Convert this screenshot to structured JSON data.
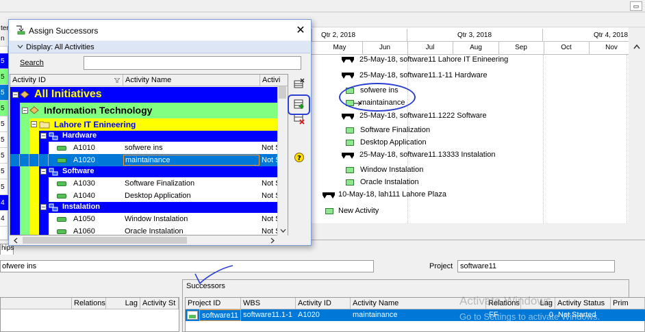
{
  "gantt": {
    "quarters": [
      "Qtr 2, 2018",
      "Qtr 3, 2018",
      "Qtr 4, 2018"
    ],
    "months": [
      "May",
      "Jun",
      "Jul",
      "Aug",
      "Sep",
      "Oct",
      "Nov"
    ],
    "rows": [
      {
        "label": "25-May-18, software11  Lahore IT Enineering",
        "kind": "summary"
      },
      {
        "label": "25-May-18, software11.1-11  Hardware",
        "kind": "summary"
      },
      {
        "label": "sofwere ins",
        "kind": "activity"
      },
      {
        "label": "maintainance",
        "kind": "activity"
      },
      {
        "label": "25-May-18, software11.1222  Software",
        "kind": "summary"
      },
      {
        "label": "Software Finalization",
        "kind": "activity"
      },
      {
        "label": "Desktop Application",
        "kind": "activity"
      },
      {
        "label": "25-May-18, software11.13333  Instalation",
        "kind": "summary"
      },
      {
        "label": "Window Instalation",
        "kind": "activity"
      },
      {
        "label": "Oracle Instalation",
        "kind": "activity"
      },
      {
        "label": "10-May-18, lah111  Lahore Plaza",
        "kind": "summary"
      },
      {
        "label": "New Activity",
        "kind": "activity"
      }
    ]
  },
  "left_column": {
    "header": "ter",
    "col_header": "n",
    "cells": [
      "5",
      "5",
      "5",
      "5",
      "5",
      "5",
      "5",
      "5",
      "5",
      "5",
      "4",
      "4"
    ]
  },
  "dialog": {
    "title": "Assign Successors",
    "close_glyph": "✕",
    "display_label": "Display: All Activities",
    "search_label": "Search",
    "search_value": "",
    "columns": [
      "Activity ID",
      "Activity Name",
      "Activi"
    ],
    "tree": [
      {
        "label": "All  Initiatives",
        "level": 0
      },
      {
        "label": "Information Technology",
        "level": 1
      },
      {
        "label": "Lahore IT Enineering",
        "level": 2
      },
      {
        "label": "Hardware",
        "level": 3
      }
    ],
    "activities": [
      {
        "id": "A1010",
        "name": "sofwere ins",
        "status": "Not S"
      },
      {
        "id": "A1020",
        "name": "maintainance",
        "status": "Not S"
      },
      {
        "id": "A1030",
        "name": "Software Finalization",
        "status": "Not S"
      },
      {
        "id": "A1040",
        "name": "Desktop Application",
        "status": "Not S"
      },
      {
        "id": "A1050",
        "name": "Window Instalation",
        "status": "Not S"
      },
      {
        "id": "A1060",
        "name": "Oracle Instalation",
        "status": "Not S"
      }
    ],
    "groups": {
      "software": "Software",
      "instalation": "Instalation"
    }
  },
  "bottom": {
    "tab_label": "hips",
    "activity_value": "ofwere ins",
    "project_label": "Project",
    "project_value": "software11",
    "pred_columns": [
      "Relations",
      "Lag",
      "Activity St"
    ],
    "successors_title": "Successors",
    "succ_columns": [
      "Project ID",
      "WBS",
      "Activity ID",
      "Activity Name",
      "Relations",
      "Lag",
      "Activity Status",
      "Prim"
    ],
    "succ_row": {
      "project_id": "software11",
      "wbs": "software11.1-1",
      "activity_id": "A1020",
      "activity_name": "maintainance",
      "relations": "FF",
      "lag": "0",
      "status": "Not Started"
    },
    "watermark_title": "Activate Windows",
    "watermark_sub": "Go to Settings to activate Windows."
  },
  "colors": {
    "level0": "#0000ff",
    "level1": "#80ff80",
    "level2": "#ffff00",
    "selection": "#0078d7",
    "annotation": "#2b3fd1"
  }
}
